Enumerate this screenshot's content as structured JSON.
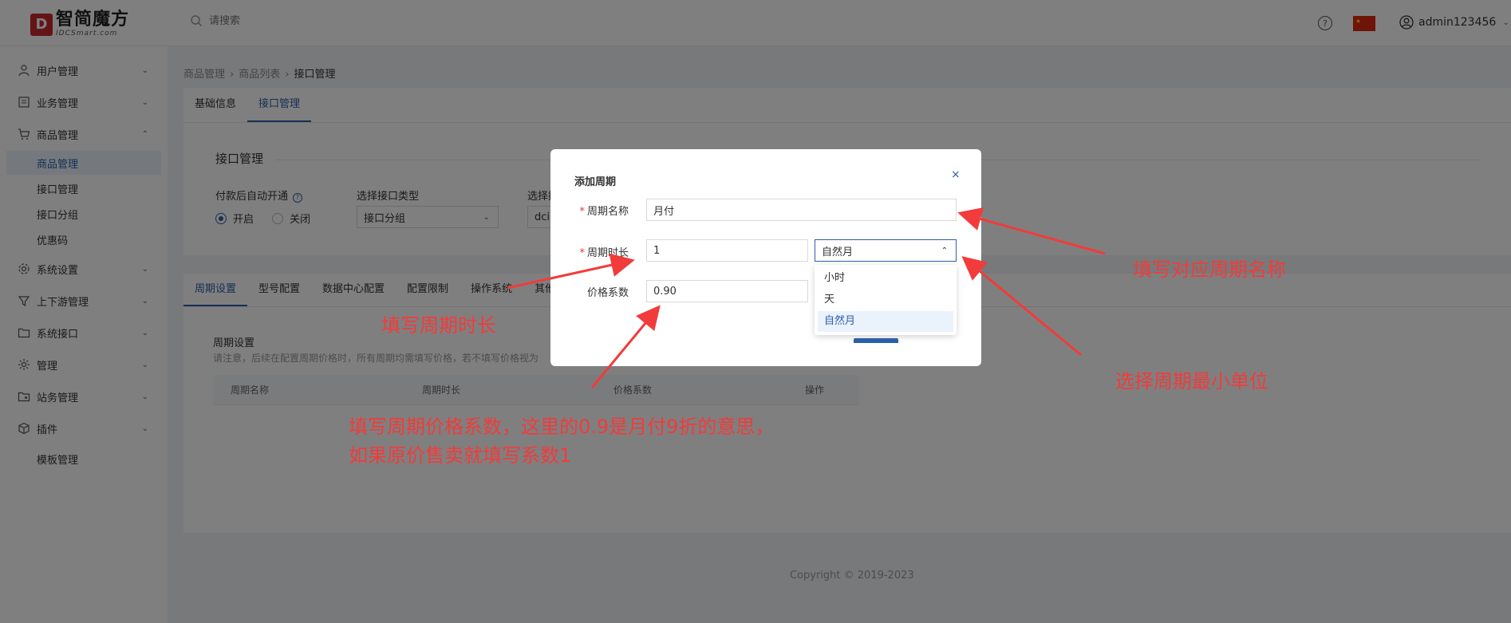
{
  "header": {
    "logo_mark": "D",
    "logo_cn": "智简魔方",
    "logo_en": "IDCSmart.com",
    "search_placeholder": "请搜索",
    "help": "?",
    "username": "admin123456",
    "flag_color": "#de2910"
  },
  "sidebar": {
    "items": [
      {
        "label": "用户管理",
        "icon": "user-icon"
      },
      {
        "label": "业务管理",
        "icon": "document-icon"
      },
      {
        "label": "商品管理",
        "icon": "cart-icon"
      },
      {
        "label": "系统设置",
        "icon": "settings-icon"
      },
      {
        "label": "上下游管理",
        "icon": "filter-icon"
      },
      {
        "label": "系统接口",
        "icon": "folder-icon"
      },
      {
        "label": "管理",
        "icon": "sun-icon"
      },
      {
        "label": "站务管理",
        "icon": "folder-user-icon"
      },
      {
        "label": "插件",
        "icon": "cube-icon"
      }
    ],
    "sub_items": [
      "商品管理",
      "接口管理",
      "接口分组",
      "优惠码"
    ],
    "template_item": "模板管理"
  },
  "breadcrumb": [
    "商品管理",
    "商品列表",
    "接口管理"
  ],
  "top_tabs": [
    "基础信息",
    "接口管理"
  ],
  "interface": {
    "title": "接口管理",
    "auto_open_label": "付款后自动开通",
    "radio_on": "开启",
    "radio_off": "关闭",
    "type_label": "选择接口类型",
    "type_value": "接口分组",
    "interface_label": "选择接",
    "interface_value": "dci"
  },
  "mid_tabs": [
    "周期设置",
    "型号配置",
    "数据中心配置",
    "配置限制",
    "操作系统",
    "其他"
  ],
  "period": {
    "title": "周期设置",
    "desc": "请注意，后续在配置周期价格时，所有周期均需填写价格，若不填写价格视为",
    "columns": [
      "周期名称",
      "周期时长",
      "价格系数",
      "操作"
    ]
  },
  "copyright": "Copyright © 2019-2023",
  "dialog": {
    "title": "添加周期",
    "close": "×",
    "required_mark": "*",
    "name_label": "周期名称",
    "name_value": "月付",
    "duration_label": "周期时长",
    "duration_value": "1",
    "unit_value": "自然月",
    "coef_label": "价格系数",
    "coef_value": "0.90",
    "options": [
      "小时",
      "天",
      "自然月"
    ],
    "selected_option": "自然月"
  },
  "annotations": {
    "name": "填写对应周期名称",
    "duration": "填写周期时长",
    "unit": "选择周期最小单位",
    "coef_line1": "填写周期价格系数，这里的0.9是月付9折的意思，",
    "coef_line2": "如果原价售卖就填写系数1",
    "color": "#f23b3b"
  },
  "colors": {
    "accent": "#2c5fa8",
    "required": "#e53935"
  }
}
